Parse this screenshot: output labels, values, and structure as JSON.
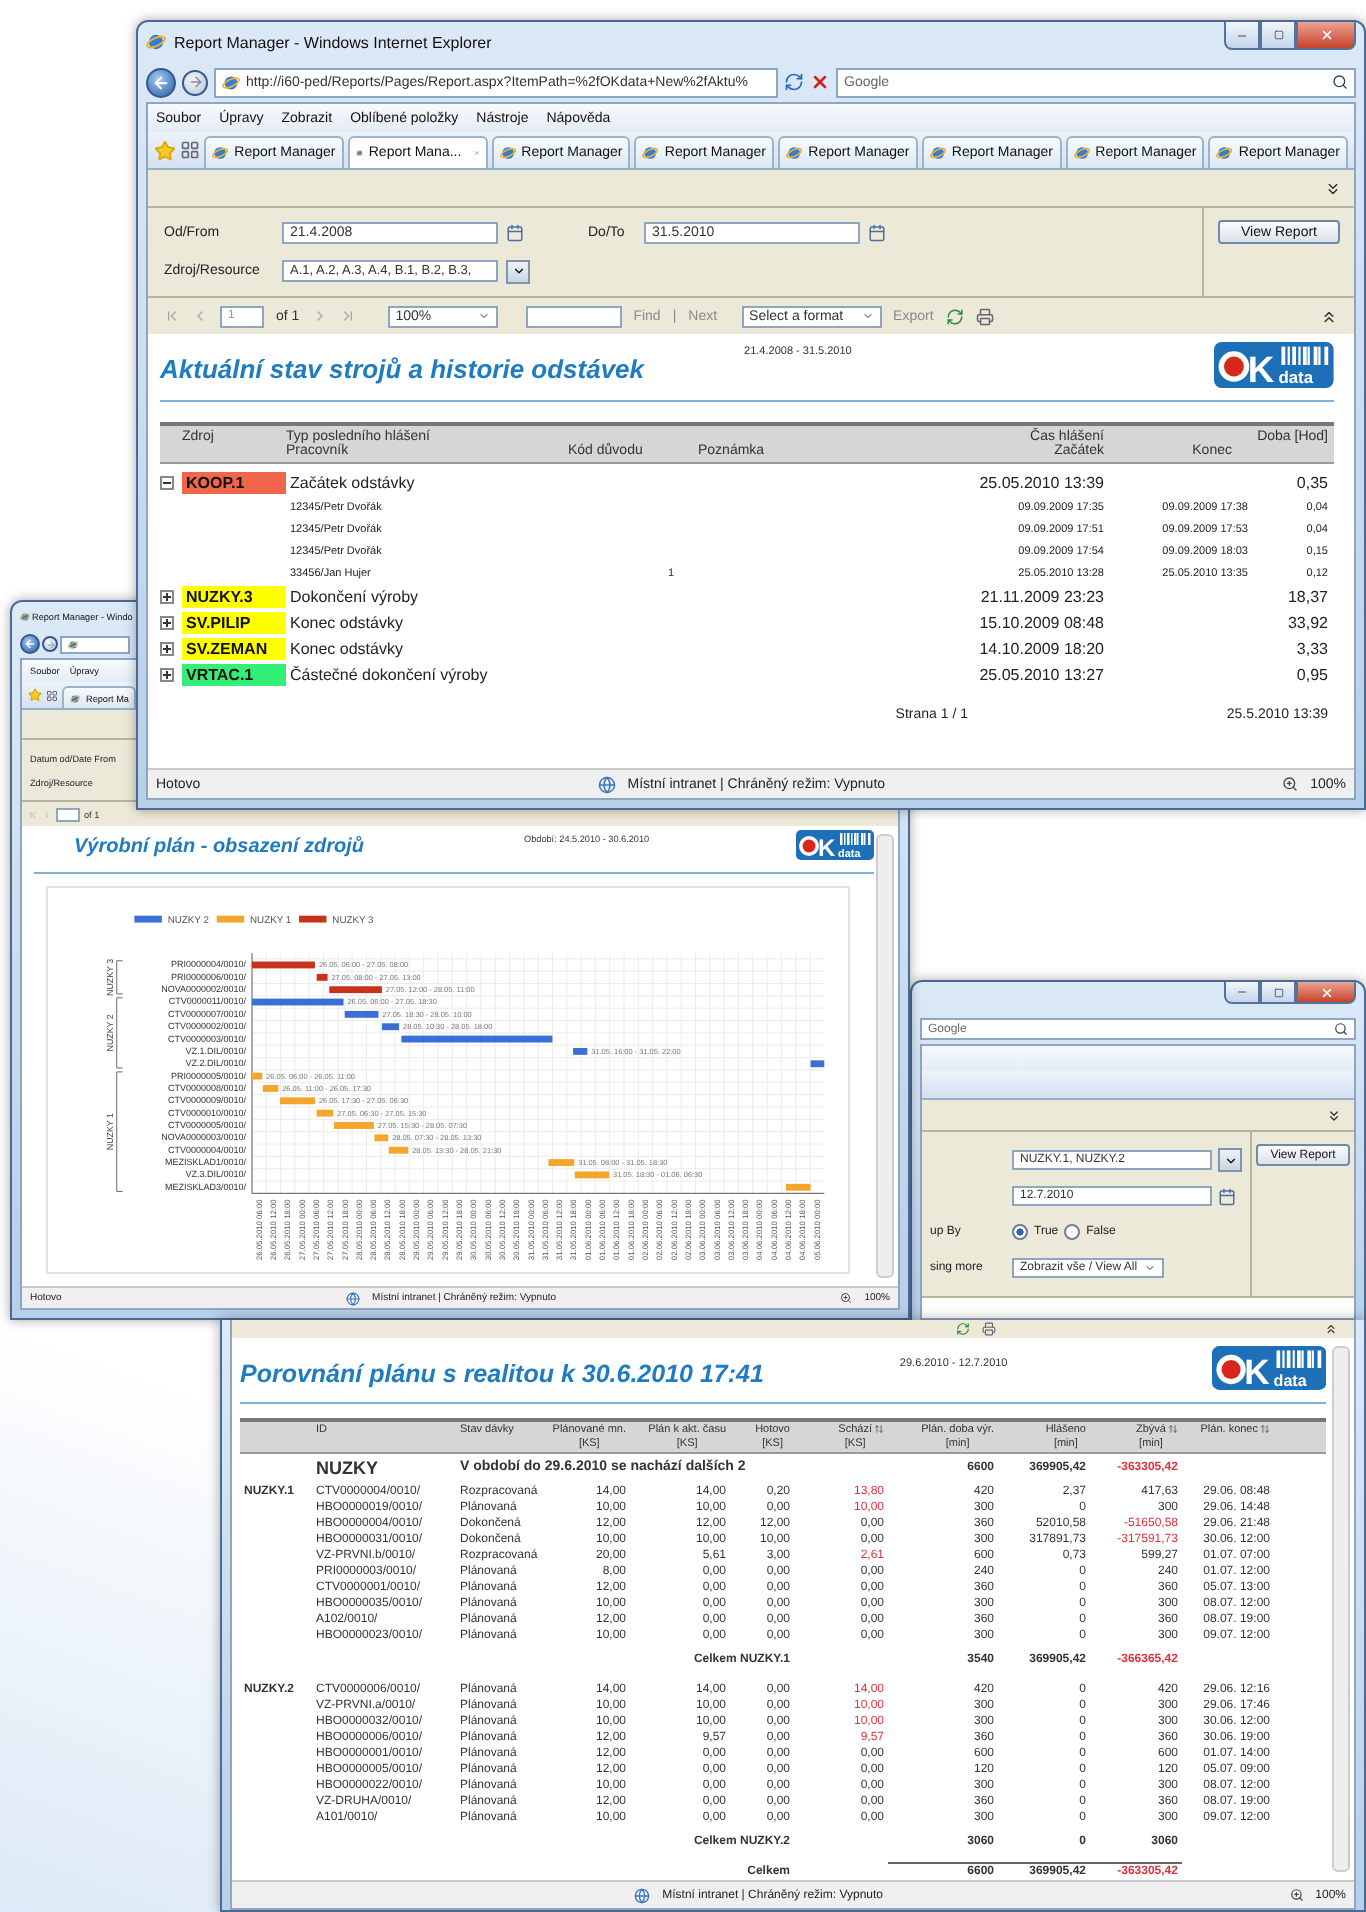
{
  "main_window": {
    "title": "Report Manager - Windows Internet Explorer",
    "address": "http://i60-ped/Reports/Pages/Report.aspx?ItemPath=%2fOKdata+New%2fAktu%",
    "search": {
      "placeholder": "Google"
    },
    "menu": [
      "Soubor",
      "Úpravy",
      "Zobrazit",
      "Oblíbené položky",
      "Nástroje",
      "Nápověda"
    ],
    "tabs": [
      {
        "label": "Report Manager",
        "selected": false
      },
      {
        "label": "Report Mana...",
        "selected": true
      },
      {
        "label": "Report Manager",
        "selected": false
      },
      {
        "label": "Report Manager",
        "selected": false
      },
      {
        "label": "Report Manager",
        "selected": false
      },
      {
        "label": "Report Manager",
        "selected": false
      },
      {
        "label": "Report Manager",
        "selected": false
      },
      {
        "label": "Report Manager",
        "selected": false
      }
    ],
    "parameters": {
      "from_label": "Od/From",
      "from_value": "21.4.2008",
      "to_label": "Do/To",
      "to_value": "31.5.2010",
      "resource_label": "Zdroj/Resource",
      "resource_value": "A.1, A.2, A.3, A.4, B.1, B.2, B.3,",
      "button": "View Report"
    },
    "toolbar": {
      "page": "1",
      "of": "of 1",
      "zoom": "100%",
      "find": "Find",
      "separator": "|",
      "next": "Next",
      "format": "Select a format",
      "export": "Export"
    },
    "report": {
      "title": "Aktuální stav strojů a historie odstávek",
      "period": "21.4.2008 - 31.5.2010",
      "logo": {
        "letter": "K",
        "word": "data"
      },
      "header": {
        "resource": "Zdroj",
        "type": "Typ posledního hlášení",
        "worker": "Pracovník",
        "code": "Kód důvodu",
        "note": "Poznámka",
        "time": "Čas hlášení",
        "start": "Začátek",
        "end": "Konec",
        "duration": "Doba [Hod]"
      },
      "groups": [
        {
          "resource": "KOOP.1",
          "color": "#f0664a",
          "expanded": true,
          "type": "Začátek odstávky",
          "time": "25.05.2010 13:39",
          "duration": "0,35",
          "children": [
            {
              "worker": "12345/Petr Dvořák",
              "start": "09.09.2009 17:35",
              "end": "09.09.2009 17:38",
              "duration": "0,04"
            },
            {
              "worker": "12345/Petr Dvořák",
              "start": "09.09.2009 17:51",
              "end": "09.09.2009 17:53",
              "duration": "0,04"
            },
            {
              "worker": "12345/Petr Dvořák",
              "start": "09.09.2009 17:54",
              "end": "09.09.2009 18:03",
              "duration": "0,15"
            },
            {
              "worker": "33456/Jan Hujer",
              "code": "1",
              "start": "25.05.2010 13:28",
              "end": "25.05.2010 13:35",
              "duration": "0,12"
            }
          ]
        },
        {
          "resource": "NUZKY.3",
          "color": "#ffff00",
          "expanded": false,
          "type": "Dokončení výroby",
          "time": "21.11.2009 23:23",
          "duration": "18,37"
        },
        {
          "resource": "SV.PILIP",
          "color": "#ffff00",
          "expanded": false,
          "type": "Konec odstávky",
          "time": "15.10.2009 08:48",
          "duration": "33,92"
        },
        {
          "resource": "SV.ZEMAN",
          "color": "#ffff00",
          "expanded": false,
          "type": "Konec odstávky",
          "time": "14.10.2009 18:20",
          "duration": "3,33"
        },
        {
          "resource": "VRTAC.1",
          "color": "#33ee77",
          "expanded": false,
          "type": "Částečné dokončení výroby",
          "time": "25.05.2010 13:27",
          "duration": "0,95"
        }
      ],
      "page": "Strana 1 / 1",
      "printed": "25.5.2010 13:39"
    },
    "status_bar": {
      "text": "Hotovo",
      "zone": "Místní intranet | Chráněný režim: Vypnuto",
      "zoom": "100%"
    }
  },
  "chart_window": {
    "title": "Report Manager - Windo",
    "menu": [
      "Soubor",
      "Úpravy"
    ],
    "tab": "Report Ma",
    "parameters": [
      "Datum od/Date From",
      "Zdroj/Resource"
    ],
    "toolbar": {
      "of": "of 1"
    },
    "report": {
      "title": "Výrobní plán - obsazení zdrojů",
      "period": "Období:  24.5.2010 - 30.6.2010",
      "logo": {
        "letter": "K",
        "word": "data"
      },
      "legend": [
        {
          "name": "NUZKY 2",
          "color": "#3a6fd6"
        },
        {
          "name": "NUZKY 1",
          "color": "#f4a52a"
        },
        {
          "name": "NUZKY 3",
          "color": "#c8321c"
        }
      ],
      "groups": [
        {
          "label": "NUZKY 3",
          "rows": [
            {
              "label": "PRI0000004/0010/",
              "bar_label": "26.05. 06:00 - 27.05. 08:00",
              "color": "#c8321c"
            },
            {
              "label": "PRI0000006/0010/",
              "bar_label": "27.05. 08:00 - 27.05. 13:00",
              "color": "#c8321c"
            },
            {
              "label": "NOVA0000002/0010/",
              "bar_label": "27.05. 12:00 - 28.05. 11:00",
              "color": "#c8321c"
            }
          ]
        },
        {
          "label": "NUZKY 2",
          "rows": [
            {
              "label": "CTV0000011/0010/",
              "bar_label": "26.05. 06:00 - 27.05. 18:30",
              "color": "#3a6fd6"
            },
            {
              "label": "CTV0000007/0010/",
              "bar_label": "27.05. 18:30 - 28.05. 10:00",
              "color": "#3a6fd6"
            },
            {
              "label": "CTV0000002/0010/",
              "bar_label": "28.05. 10:30 - 28.05. 18:00",
              "color": "#3a6fd6"
            },
            {
              "label": "CTV0000003/0010/",
              "color": "#3a6fd6"
            },
            {
              "label": "VZ.1.DIL/0010/",
              "bar_label": "31.05. 16:00 - 31.05. 22:00",
              "color": "#3a6fd6"
            },
            {
              "label": "VZ.2.DIL/0010/",
              "color": "#3a6fd6"
            }
          ]
        },
        {
          "label": "NUZKY 1",
          "rows": [
            {
              "label": "PRI0000005/0010/",
              "bar_label": "26.05. 06:00 - 26.05. 11:00",
              "color": "#f4a52a"
            },
            {
              "label": "CTV0000008/0010/",
              "bar_label": "26.05. 11:00 - 26.05. 17:30",
              "color": "#f4a52a"
            },
            {
              "label": "CTV0000009/0010/",
              "bar_label": "26.05. 17:30 - 27.05. 06:30",
              "color": "#f4a52a"
            },
            {
              "label": "CTV0000010/0010/",
              "bar_label": "27.05. 06:30 - 27.05. 15:30",
              "color": "#f4a52a"
            },
            {
              "label": "CTV0000005/0010/",
              "bar_label": "27.05. 15:30 - 28.05. 07:30",
              "color": "#f4a52a"
            },
            {
              "label": "NOVA0000003/0010/",
              "bar_label": "28.05. 07:30 - 28.05. 13:30",
              "color": "#f4a52a"
            },
            {
              "label": "CTV0000004/0010/",
              "bar_label": "28.05. 13:30 - 28.05. 21:30",
              "color": "#f4a52a"
            },
            {
              "label": "MEZISKLAD1/0010/",
              "bar_label": "31.05. 08:00 - 31.05. 18:30",
              "color": "#f4a52a"
            },
            {
              "label": "VZ.3.DIL/0010/",
              "bar_label": "31.05. 18:30 - 01.06. 06:30",
              "color": "#f4a52a"
            },
            {
              "label": "MEZISKLAD3/0010/",
              "color": "#f4a52a"
            }
          ]
        }
      ],
      "ticks": [
        "26.05.2010 06:00",
        "26.05.2010 12:00",
        "26.05.2010 18:00",
        "27.05.2010 00:00",
        "27.05.2010 06:00",
        "27.05.2010 12:00",
        "27.05.2010 18:00",
        "28.05.2010 00:00",
        "28.05.2010 06:00",
        "28.05.2010 12:00",
        "28.05.2010 18:00",
        "29.05.2010 00:00",
        "29.05.2010 06:00",
        "29.05.2010 12:00",
        "29.05.2010 18:00",
        "30.05.2010 00:00",
        "30.05.2010 06:00",
        "30.05.2010 12:00",
        "30.05.2010 18:00",
        "31.05.2010 00:00",
        "31.05.2010 06:00",
        "31.05.2010 12:00",
        "31.05.2010 18:00",
        "01.06.2010 00:00",
        "01.06.2010 06:00",
        "01.06.2010 12:00",
        "01.06.2010 18:00",
        "02.06.2010 00:00",
        "02.06.2010 06:00",
        "02.06.2010 12:00",
        "02.06.2010 18:00",
        "03.06.2010 00:00",
        "03.06.2010 06:00",
        "03.06.2010 12:00",
        "03.06.2010 18:00",
        "04.06.2010 00:00",
        "04.06.2010 06:00",
        "04.06.2010 12:00",
        "04.06.2010 18:00",
        "05.06.2010 00:00"
      ]
    },
    "status_bar": {
      "text": "Hotovo",
      "zone": "Místní intranet | Chráněný režim: Vypnuto",
      "zoom": "100%"
    }
  },
  "filter_window": {
    "search": {
      "placeholder": "Google"
    },
    "resource_value": "NUZKY.1, NUZKY.2",
    "date_value": "12.7.2010",
    "group_label": "up By",
    "group_options": [
      {
        "label": "True",
        "selected": true
      },
      {
        "label": "False",
        "selected": false
      }
    ],
    "more_label": "sing more",
    "view_value": "Zobrazit vše / View All",
    "button": "View Report"
  },
  "comparison_window": {
    "report": {
      "title": "Porovnání plánu s realitou k 30.6.2010 17:41",
      "period": "29.6.2010 - 12.7.2010",
      "logo": {
        "letter": "K",
        "word": "data"
      },
      "columns": [
        {
          "label": "ID"
        },
        {
          "label": "Stav dávky"
        },
        {
          "label": "Plánované mn.",
          "unit": "[KS]"
        },
        {
          "label": "Plán k akt. času",
          "unit": "[KS]"
        },
        {
          "label": "Hotovo",
          "unit": "[KS]"
        },
        {
          "label": "Schází",
          "unit": "[KS]",
          "sortable": true
        },
        {
          "label": "Plán. doba výr.",
          "unit": "[min]"
        },
        {
          "label": "Hlášeno",
          "unit": "[min]"
        },
        {
          "label": "Zbývá",
          "unit": "[min]",
          "sortable": true
        },
        {
          "label": "Plán. konec",
          "sortable": true
        }
      ],
      "summary": {
        "name": "NUZKY",
        "note": "V období do 29.6.2010 se nachází dalších 2",
        "duration": "6600",
        "reported": "369905,42",
        "remaining": "-363305,42",
        "remaining_alert": true
      },
      "groups": [
        {
          "name": "NUZKY.1",
          "rows": [
            {
              "cells": [
                "CTV0000004/0010/",
                "Rozpracovaná",
                "14,00",
                "14,00",
                "0,20",
                "13,80",
                "420",
                "2,37",
                "417,63",
                "29.06. 08:48"
              ],
              "short_alert": true,
              "remaining_alert": false
            },
            {
              "cells": [
                "HBO0000019/0010/",
                "Plánovaná",
                "10,00",
                "10,00",
                "0,00",
                "10,00",
                "300",
                "0",
                "300",
                "29.06. 14:48"
              ],
              "short_alert": true,
              "remaining_alert": false
            },
            {
              "cells": [
                "HBO0000004/0010/",
                "Dokončená",
                "12,00",
                "12,00",
                "12,00",
                "0,00",
                "360",
                "52010,58",
                "-51650,58",
                "29.06. 21:48"
              ],
              "short_alert": false,
              "remaining_alert": true
            },
            {
              "cells": [
                "HBO0000031/0010/",
                "Dokončená",
                "10,00",
                "10,00",
                "10,00",
                "0,00",
                "300",
                "317891,73",
                "-317591,73",
                "30.06. 12:00"
              ],
              "short_alert": false,
              "remaining_alert": true
            },
            {
              "cells": [
                "VZ-PRVNI.b/0010/",
                "Rozpracovaná",
                "20,00",
                "5,61",
                "3,00",
                "2,61",
                "600",
                "0,73",
                "599,27",
                "01.07. 07:00"
              ],
              "short_alert": true,
              "remaining_alert": false
            },
            {
              "cells": [
                "PRI0000003/0010/",
                "Plánovaná",
                "8,00",
                "0,00",
                "0,00",
                "0,00",
                "240",
                "0",
                "240",
                "01.07. 12:00"
              ],
              "short_alert": false,
              "remaining_alert": false
            },
            {
              "cells": [
                "CTV0000001/0010/",
                "Plánovaná",
                "12,00",
                "0,00",
                "0,00",
                "0,00",
                "360",
                "0",
                "360",
                "05.07. 13:00"
              ],
              "short_alert": false,
              "remaining_alert": false
            },
            {
              "cells": [
                "HBO0000035/0010/",
                "Plánovaná",
                "10,00",
                "0,00",
                "0,00",
                "0,00",
                "300",
                "0",
                "300",
                "08.07. 12:00"
              ],
              "short_alert": false,
              "remaining_alert": false
            },
            {
              "cells": [
                "A102/0010/",
                "Plánovaná",
                "12,00",
                "0,00",
                "0,00",
                "0,00",
                "360",
                "0",
                "360",
                "08.07. 19:00"
              ],
              "short_alert": false,
              "remaining_alert": false
            },
            {
              "cells": [
                "HBO0000023/0010/",
                "Plánovaná",
                "10,00",
                "0,00",
                "0,00",
                "0,00",
                "300",
                "0",
                "300",
                "09.07. 12:00"
              ],
              "short_alert": false,
              "remaining_alert": false
            }
          ],
          "total": {
            "label": "Celkem NUZKY.1",
            "duration": "3540",
            "reported": "369905,42",
            "remaining": "-366365,42",
            "remaining_alert": true
          }
        },
        {
          "name": "NUZKY.2",
          "rows": [
            {
              "cells": [
                "CTV0000006/0010/",
                "Plánovaná",
                "14,00",
                "14,00",
                "0,00",
                "14,00",
                "420",
                "0",
                "420",
                "29.06. 12:16"
              ],
              "short_alert": true,
              "remaining_alert": false
            },
            {
              "cells": [
                "VZ-PRVNI.a/0010/",
                "Plánovaná",
                "10,00",
                "10,00",
                "0,00",
                "10,00",
                "300",
                "0",
                "300",
                "29.06. 17:46"
              ],
              "short_alert": true,
              "remaining_alert": false
            },
            {
              "cells": [
                "HBO0000032/0010/",
                "Plánovaná",
                "10,00",
                "10,00",
                "0,00",
                "10,00",
                "300",
                "0",
                "300",
                "30.06. 12:00"
              ],
              "short_alert": true,
              "remaining_alert": false
            },
            {
              "cells": [
                "HBO0000006/0010/",
                "Plánovaná",
                "12,00",
                "9,57",
                "0,00",
                "9,57",
                "360",
                "0",
                "360",
                "30.06. 19:00"
              ],
              "short_alert": true,
              "remaining_alert": false
            },
            {
              "cells": [
                "HBO0000001/0010/",
                "Plánovaná",
                "12,00",
                "0,00",
                "0,00",
                "0,00",
                "600",
                "0",
                "600",
                "01.07. 14:00"
              ],
              "short_alert": false,
              "remaining_alert": false
            },
            {
              "cells": [
                "HBO0000005/0010/",
                "Plánovaná",
                "12,00",
                "0,00",
                "0,00",
                "0,00",
                "120",
                "0",
                "120",
                "05.07. 09:00"
              ],
              "short_alert": false,
              "remaining_alert": false
            },
            {
              "cells": [
                "HBO0000022/0010/",
                "Plánovaná",
                "10,00",
                "0,00",
                "0,00",
                "0,00",
                "300",
                "0",
                "300",
                "08.07. 12:00"
              ],
              "short_alert": false,
              "remaining_alert": false
            },
            {
              "cells": [
                "VZ-DRUHA/0010/",
                "Plánovaná",
                "12,00",
                "0,00",
                "0,00",
                "0,00",
                "360",
                "0",
                "360",
                "08.07. 19:00"
              ],
              "short_alert": false,
              "remaining_alert": false
            },
            {
              "cells": [
                "A101/0010/",
                "Plánovaná",
                "10,00",
                "0,00",
                "0,00",
                "0,00",
                "300",
                "0",
                "300",
                "09.07. 12:00"
              ],
              "short_alert": false,
              "remaining_alert": false
            }
          ],
          "total": {
            "label": "Celkem NUZKY.2",
            "duration": "3060",
            "reported": "0",
            "remaining": "3060",
            "remaining_alert": false
          }
        }
      ],
      "grand_total": {
        "label": "Celkem",
        "duration": "6600",
        "reported": "369905,42",
        "remaining": "-363305,42",
        "remaining_alert": true
      }
    },
    "status_bar": {
      "zone": "Místní intranet | Chráněný režim: Vypnuto",
      "zoom": "100%"
    }
  }
}
